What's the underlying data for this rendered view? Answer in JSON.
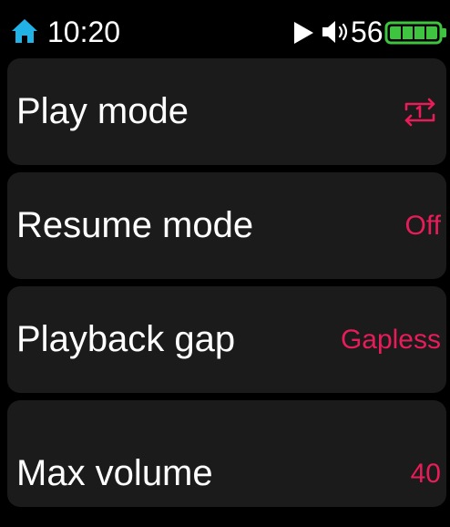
{
  "status_bar": {
    "time": "10:20",
    "volume": "56",
    "icons": [
      "home-icon",
      "play-icon",
      "volume-icon",
      "battery-icon"
    ],
    "home_icon_color": "#21b3e8",
    "battery_color": "#3ec43e",
    "battery_level": 1.0
  },
  "settings": {
    "accent_color": "#e81c59",
    "items": [
      {
        "label": "Play mode",
        "value_icon": "repeat-one-icon"
      },
      {
        "label": "Resume mode",
        "value": "Off"
      },
      {
        "label": "Playback gap",
        "value": "Gapless"
      },
      {
        "label": "Max volume",
        "value": "40"
      }
    ]
  }
}
